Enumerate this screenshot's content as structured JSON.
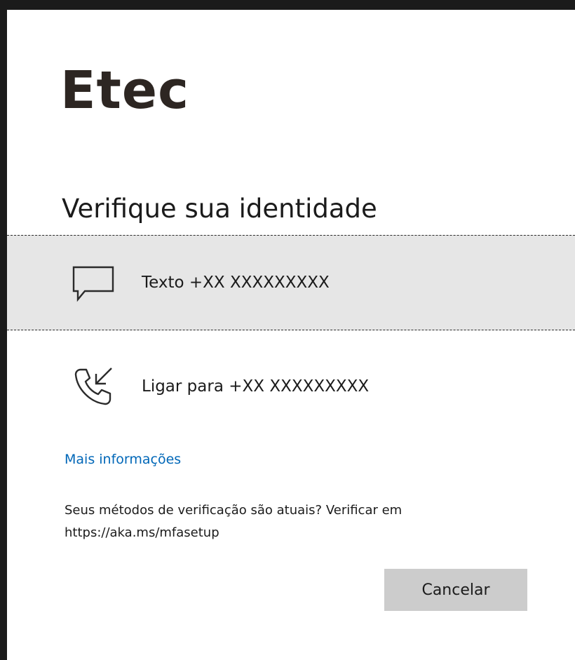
{
  "brand": {
    "logo_text": "Etec"
  },
  "page": {
    "title": "Verifique sua identidade"
  },
  "methods": [
    {
      "icon": "chat-bubble-icon",
      "label": "Texto +XX XXXXXXXXX",
      "selected": true
    },
    {
      "icon": "incoming-call-icon",
      "label": "Ligar para +XX XXXXXXXXX",
      "selected": false
    }
  ],
  "more_info": {
    "label": "Mais informações"
  },
  "notice": {
    "text": "Seus métodos de verificação são atuais? Verificar em https://aka.ms/mfasetup"
  },
  "actions": {
    "cancel_label": "Cancelar"
  },
  "colors": {
    "link": "#0067b8",
    "selected_bg": "#e6e6e6",
    "button_bg": "#cccccc",
    "page_bg": "#1b1b1b"
  }
}
